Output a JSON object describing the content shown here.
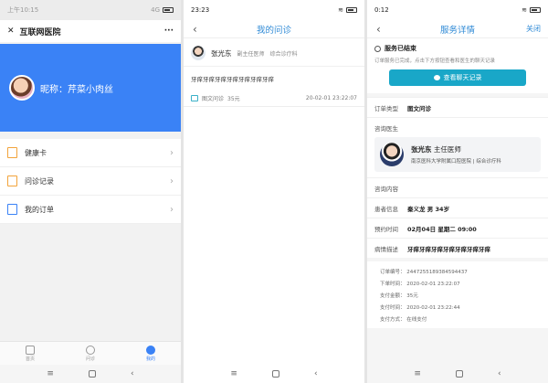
{
  "panel1": {
    "status_time": "上午10:15",
    "status_net": "4G",
    "title": "互联网医院",
    "more": "···",
    "nickname": "昵称：芹菜小肉丝",
    "menu": [
      {
        "label": "健康卡"
      },
      {
        "label": "问诊记录"
      },
      {
        "label": "我的订单"
      }
    ],
    "tabs": [
      {
        "label": "首页"
      },
      {
        "label": "问诊"
      },
      {
        "label": "我的"
      }
    ]
  },
  "panel2": {
    "status_time": "23:23",
    "title": "我的问诊",
    "doctor_name": "张光东",
    "doctor_title": "副主任医师",
    "doctor_dept": "综合诊疗科",
    "consult_text": "牙痒牙痒牙痒牙痒牙痒牙痒牙痒",
    "type_label": "图文问诊",
    "price": "35元",
    "date": "20-02-01 23:22:07"
  },
  "panel3": {
    "status_time": "0:12",
    "title": "服务详情",
    "close_label": "关闭",
    "done_title": "服务已结束",
    "done_sub": "订单服务已完成，点击下方按钮查看和医生的聊天记录",
    "chat_btn": "查看聊天记录",
    "order_type_label": "订单类型",
    "order_type_value": "图文问诊",
    "doctor_section_label": "咨询医生",
    "doctor_name": "张光东",
    "doctor_title": "主任医师",
    "doctor_hospital": "南京医科大学附属口腔医院 | 综合诊疗科",
    "consult_content_label": "咨询内容",
    "patient_label": "患者信息",
    "patient_value": "秦义龙   男   34岁",
    "appt_label": "预约时间",
    "appt_value": "02月04日   星期二   09:00",
    "illness_label": "病情描述",
    "illness_value": "牙痒牙痒牙痒牙痒牙痒牙痒牙痒",
    "order_no": "订单编号：  2447255189384594437",
    "order_time": "下单时间：  2020-02-01 23:22:07",
    "pay_amount": "支付金额：  35元",
    "pay_time": "支付时间：  2020-02-01 23:22:44",
    "pay_method": "支付方式：  在线支付"
  }
}
